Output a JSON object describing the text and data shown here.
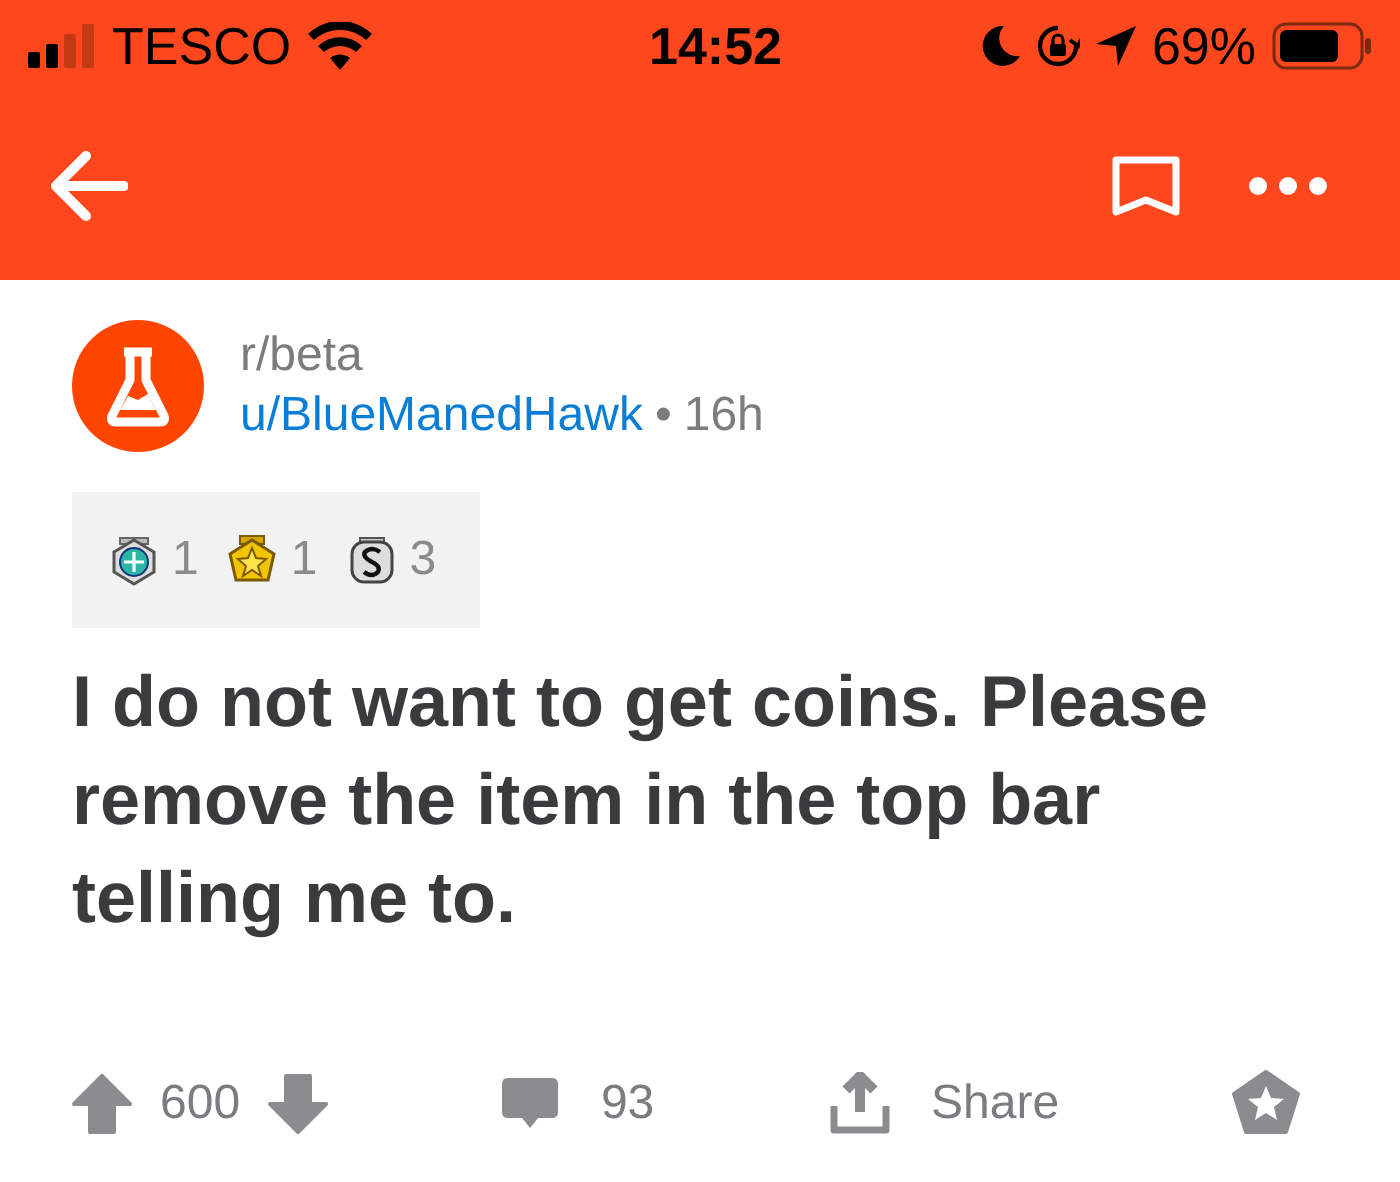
{
  "status_bar": {
    "carrier": "TESCO",
    "time": "14:52",
    "battery": "69%"
  },
  "post": {
    "subreddit": "r/beta",
    "author": "u/BlueManedHawk",
    "separator": "•",
    "age": "16h",
    "awards": [
      {
        "kind": "platinum",
        "count": "1"
      },
      {
        "kind": "gold",
        "count": "1"
      },
      {
        "kind": "silver",
        "count": "3"
      }
    ],
    "title": "I do not want to get coins. Please remove the item in the top bar telling me to.",
    "score": "600",
    "comments": "93",
    "share": "Share"
  }
}
